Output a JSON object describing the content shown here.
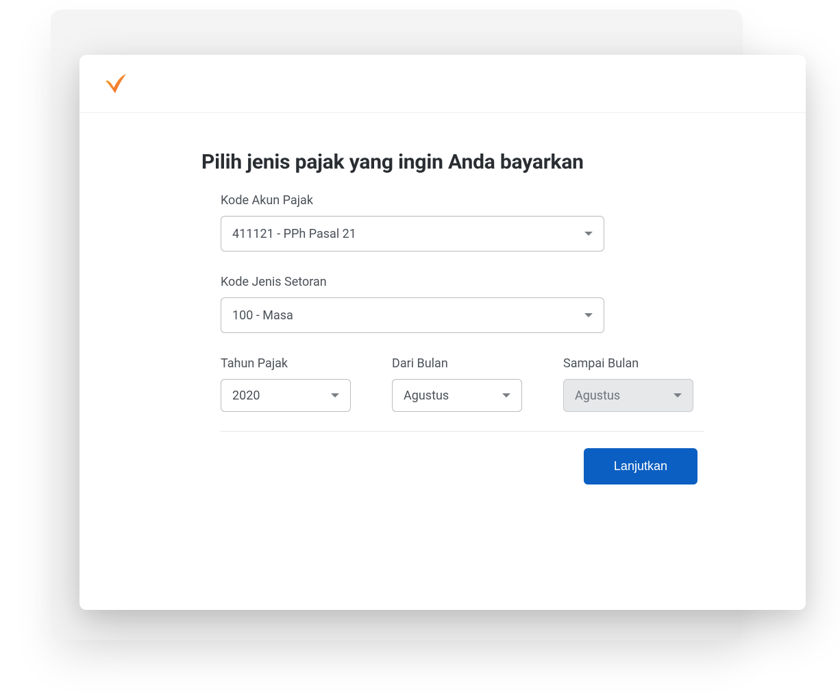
{
  "page": {
    "title": "Pilih jenis pajak yang ingin Anda bayarkan"
  },
  "form": {
    "kode_akun_pajak": {
      "label": "Kode Akun Pajak",
      "value": "411121 - PPh Pasal 21"
    },
    "kode_jenis_setoran": {
      "label": "Kode Jenis Setoran",
      "value": "100 - Masa"
    },
    "tahun_pajak": {
      "label": "Tahun Pajak",
      "value": "2020"
    },
    "dari_bulan": {
      "label": "Dari Bulan",
      "value": "Agustus"
    },
    "sampai_bulan": {
      "label": "Sampai Bulan",
      "value": "Agustus"
    }
  },
  "actions": {
    "continue_label": "Lanjutkan"
  },
  "colors": {
    "primary": "#0b5fc2",
    "logo_start": "#f5a623",
    "logo_end": "#f76b1c"
  }
}
